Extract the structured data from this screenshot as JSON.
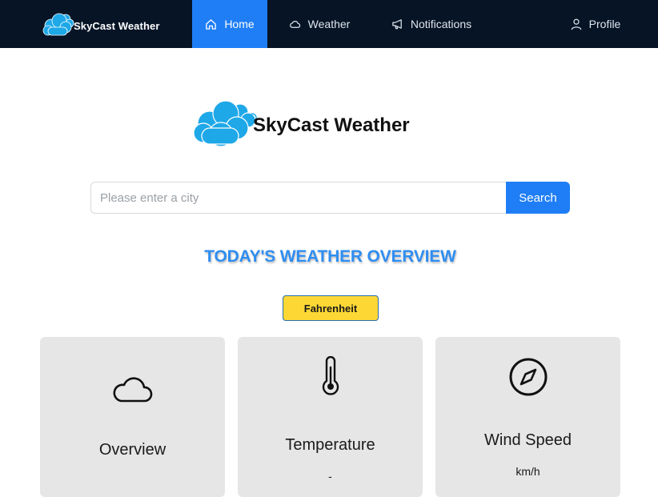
{
  "navbar": {
    "brand": "SkyCast Weather",
    "items": [
      {
        "label": "Home",
        "icon": "home-icon",
        "active": true
      },
      {
        "label": "Weather",
        "icon": "cloud-icon"
      },
      {
        "label": "Notifications",
        "icon": "megaphone-icon"
      },
      {
        "label": "Profile",
        "icon": "user-icon"
      }
    ]
  },
  "hero": {
    "title": "SkyCast Weather",
    "logo_icon": "cloud-logo-icon"
  },
  "search": {
    "placeholder": "Please enter a city",
    "value": "",
    "button_label": "Search"
  },
  "section": {
    "heading": "TODAY'S WEATHER OVERVIEW"
  },
  "unit_toggle": {
    "label": "Fahrenheit"
  },
  "cards": [
    {
      "title": "Overview",
      "value": "",
      "icon": "cloud-icon"
    },
    {
      "title": "Temperature",
      "value": "-",
      "icon": "thermometer-icon"
    },
    {
      "title": "Wind Speed",
      "value": "km/h",
      "icon": "compass-icon"
    }
  ],
  "colors": {
    "navbar_bg": "#061426",
    "accent": "#1f7ef5",
    "heading": "#2f8df0",
    "toggle_bg": "#fdd835",
    "card_bg": "#e6e6e6",
    "logo_cloud": "#1ea8e8"
  }
}
